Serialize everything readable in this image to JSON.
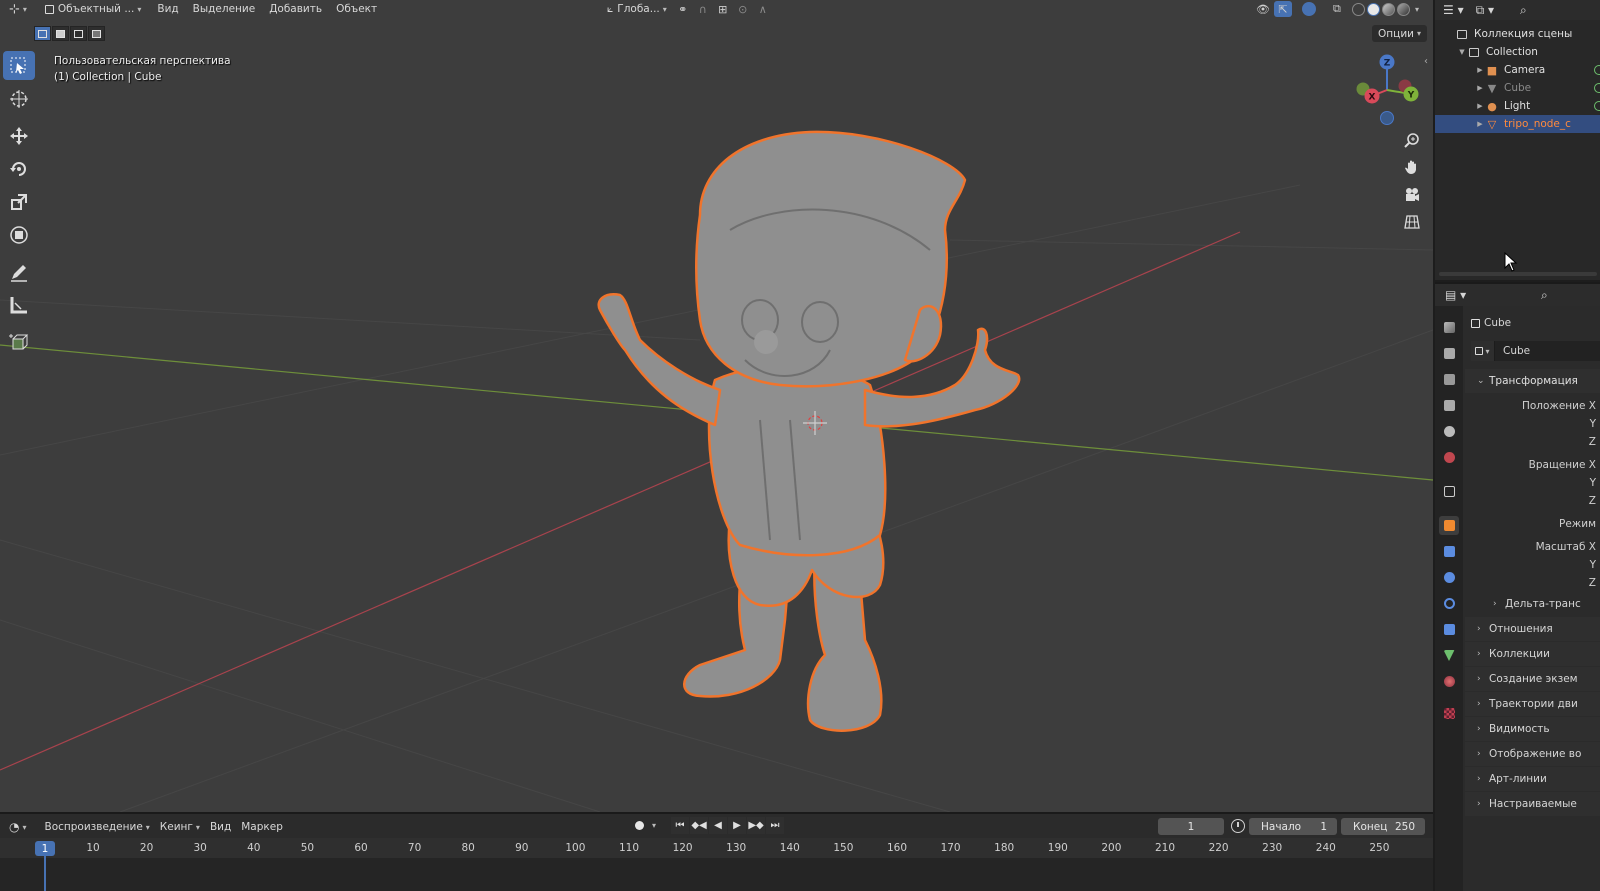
{
  "viewport": {
    "header": {
      "mode_label": "Объектный ...",
      "menus": [
        "Вид",
        "Выделение",
        "Добавить",
        "Объект"
      ],
      "transform_orientation": "Глоба...",
      "options_label": "Опции"
    },
    "info_line1": "Пользовательская перспектива",
    "info_line2": "(1) Collection | Cube",
    "gizmo_axes": {
      "x": "X",
      "y": "Y",
      "z": "Z"
    },
    "toolbar_icons": [
      "select-box-icon",
      "cursor-icon",
      "move-icon",
      "rotate-icon",
      "scale-icon",
      "transform-icon",
      "annotate-icon",
      "measure-icon",
      "add-cube-icon"
    ],
    "colors": {
      "selection_outline": "#f0742c",
      "x_axis": "#c2424c",
      "y_axis": "#7ba33a",
      "accent": "#4772b3"
    }
  },
  "timeline": {
    "menus": [
      "Воспроизведение",
      "Кеинг",
      "Вид",
      "Маркер"
    ],
    "current_frame": "1",
    "start_label": "Начало",
    "start_value": "1",
    "end_label": "Конец",
    "end_value": "250",
    "ruler_current": "1",
    "ruler_ticks": [
      "10",
      "20",
      "30",
      "40",
      "50",
      "60",
      "70",
      "80",
      "90",
      "100",
      "110",
      "120",
      "130",
      "140",
      "150",
      "160",
      "170",
      "180",
      "190",
      "200",
      "210",
      "220",
      "230",
      "240",
      "250"
    ]
  },
  "outliner": {
    "scene_collection": "Коллекция сцены",
    "collection": "Collection",
    "items": [
      {
        "name": "Camera",
        "icon": "camera-icon"
      },
      {
        "name": "Cube",
        "icon": "mesh-icon"
      },
      {
        "name": "Light",
        "icon": "light-icon"
      },
      {
        "name": "tripo_node_c",
        "icon": "mesh-icon"
      }
    ]
  },
  "properties": {
    "object_name": "Cube",
    "object_field": "Cube",
    "transform_title": "Трансформация",
    "location_label": "Положение X",
    "rotation_label": "Вращение X",
    "mode_label": "Режим",
    "scale_label": "Масштаб X",
    "axis_y": "Y",
    "axis_z": "Z",
    "delta_title": "Дельта-транс",
    "panels": [
      "Отношения",
      "Коллекции",
      "Создание экзем",
      "Траектории дви",
      "Видимость",
      "Отображение во",
      "Арт-линии",
      "Настраиваемые"
    ]
  }
}
